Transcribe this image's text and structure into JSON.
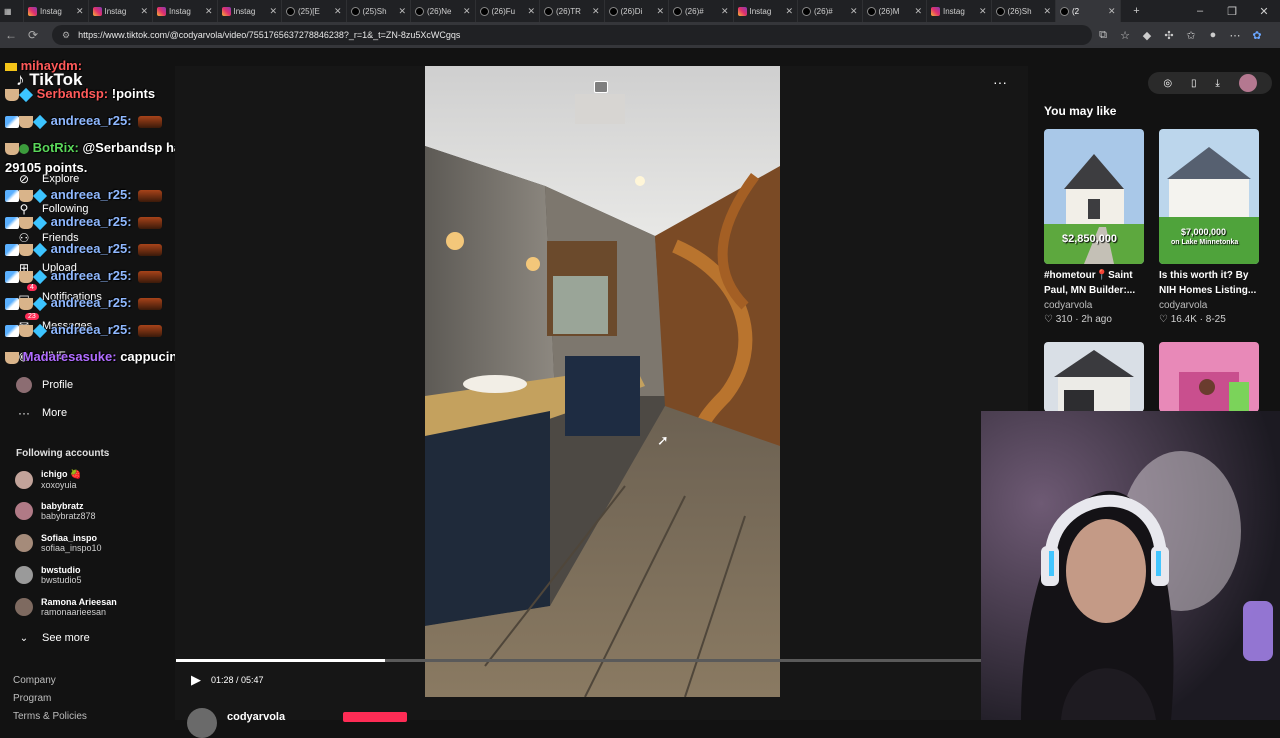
{
  "tabs": [
    {
      "label": "Instag",
      "type": "ig"
    },
    {
      "label": "Instag",
      "type": "ig"
    },
    {
      "label": "Instag",
      "type": "ig"
    },
    {
      "label": "Instag",
      "type": "ig"
    },
    {
      "label": "(25)[E",
      "type": "tt"
    },
    {
      "label": "(25)Sh",
      "type": "tt"
    },
    {
      "label": "(26)Ne",
      "type": "tt"
    },
    {
      "label": "(26)Fu",
      "type": "tt"
    },
    {
      "label": "(26)TR",
      "type": "tt"
    },
    {
      "label": "(26)Di",
      "type": "tt"
    },
    {
      "label": "(26)#",
      "type": "tt"
    },
    {
      "label": "Instag",
      "type": "ig"
    },
    {
      "label": "(26)#",
      "type": "tt"
    },
    {
      "label": "(26)M",
      "type": "tt"
    },
    {
      "label": "Instag",
      "type": "ig"
    },
    {
      "label": "(26)Sh",
      "type": "tt"
    },
    {
      "label": "(2",
      "type": "tt",
      "active": true
    }
  ],
  "browser": {
    "url": "https://www.tiktok.com/@codyarvola/video/7551765637278846238?_r=1&_t=ZN-8zu5XcWCgqs",
    "new_tab": "+",
    "min": "–",
    "max": "❐",
    "close": "✕"
  },
  "sidebar": {
    "logo": "TikTok",
    "nav": [
      {
        "label": "Explore",
        "icon": "compass-icon"
      },
      {
        "label": "Following",
        "icon": "user-follow-icon"
      },
      {
        "label": "Friends",
        "icon": "friends-icon"
      },
      {
        "label": "Upload",
        "icon": "upload-icon"
      },
      {
        "label": "Notifications",
        "icon": "bell-icon",
        "badge": "4"
      },
      {
        "label": "Messages",
        "icon": "message-icon",
        "badge": "23"
      },
      {
        "label": "LIVE",
        "icon": "live-icon"
      },
      {
        "label": "Profile",
        "icon": "profile-icon"
      },
      {
        "label": "More",
        "icon": "more-icon"
      }
    ],
    "following_title": "Following accounts",
    "accounts": [
      {
        "name": "ichigo 🍓",
        "handle": "xoxoyuia"
      },
      {
        "name": "babybratz",
        "handle": "babybratz878"
      },
      {
        "name": "Sofiaa_inspo",
        "handle": "sofiaa_inspo10"
      },
      {
        "name": "bwstudio",
        "handle": "bwstudio5"
      },
      {
        "name": "Ramona Arieesan",
        "handle": "ramonaarieesan"
      }
    ],
    "see_more": "See more",
    "footer": [
      "Company",
      "Program",
      "Terms & Policies"
    ]
  },
  "chat": [
    {
      "user": "mihaydm:",
      "msg": "",
      "color": "u1"
    },
    {
      "user": "Serbandsp:",
      "msg": "!points",
      "color": "u1"
    },
    {
      "user": "andreea_r25:",
      "msg": "",
      "color": "u2"
    },
    {
      "user": "BotRix:",
      "msg": "@Serbandsp has",
      "color": "u3"
    },
    {
      "user": "",
      "msg": "29105 points.",
      "color": "u3"
    },
    {
      "user": "andreea_r25:",
      "msg": "",
      "color": "u2"
    },
    {
      "user": "andreea_r25:",
      "msg": "",
      "color": "u2"
    },
    {
      "user": "andreea_r25:",
      "msg": "",
      "color": "u2"
    },
    {
      "user": "andreea_r25:",
      "msg": "",
      "color": "u2"
    },
    {
      "user": "andreea_r25:",
      "msg": "",
      "color": "u2"
    },
    {
      "user": "andreea_r25:",
      "msg": "",
      "color": "u2"
    },
    {
      "user": "Madaresasuke:",
      "msg": "cappucino",
      "color": "u4"
    }
  ],
  "player": {
    "time": "01:28 / 05:47",
    "progress": 0.26,
    "author": "codyarvola",
    "more": "···"
  },
  "right": {
    "title": "You may like",
    "cards": [
      {
        "caption": "#hometour📍Saint Paul, MN Builder:...",
        "author": "codyarvola",
        "likes": "310",
        "age": "2h ago",
        "price": "$2,850,000"
      },
      {
        "caption": "Is this worth it? By NIH Homes Listing...",
        "author": "codyarvola",
        "likes": "16.4K",
        "age": "8-25",
        "price": "$7,000,000",
        "sub": "on Lake Minnetonka"
      },
      {
        "caption": "",
        "author": "",
        "likes": "",
        "age": ""
      },
      {
        "caption": "",
        "author": "",
        "likes": "",
        "age": ""
      }
    ]
  }
}
